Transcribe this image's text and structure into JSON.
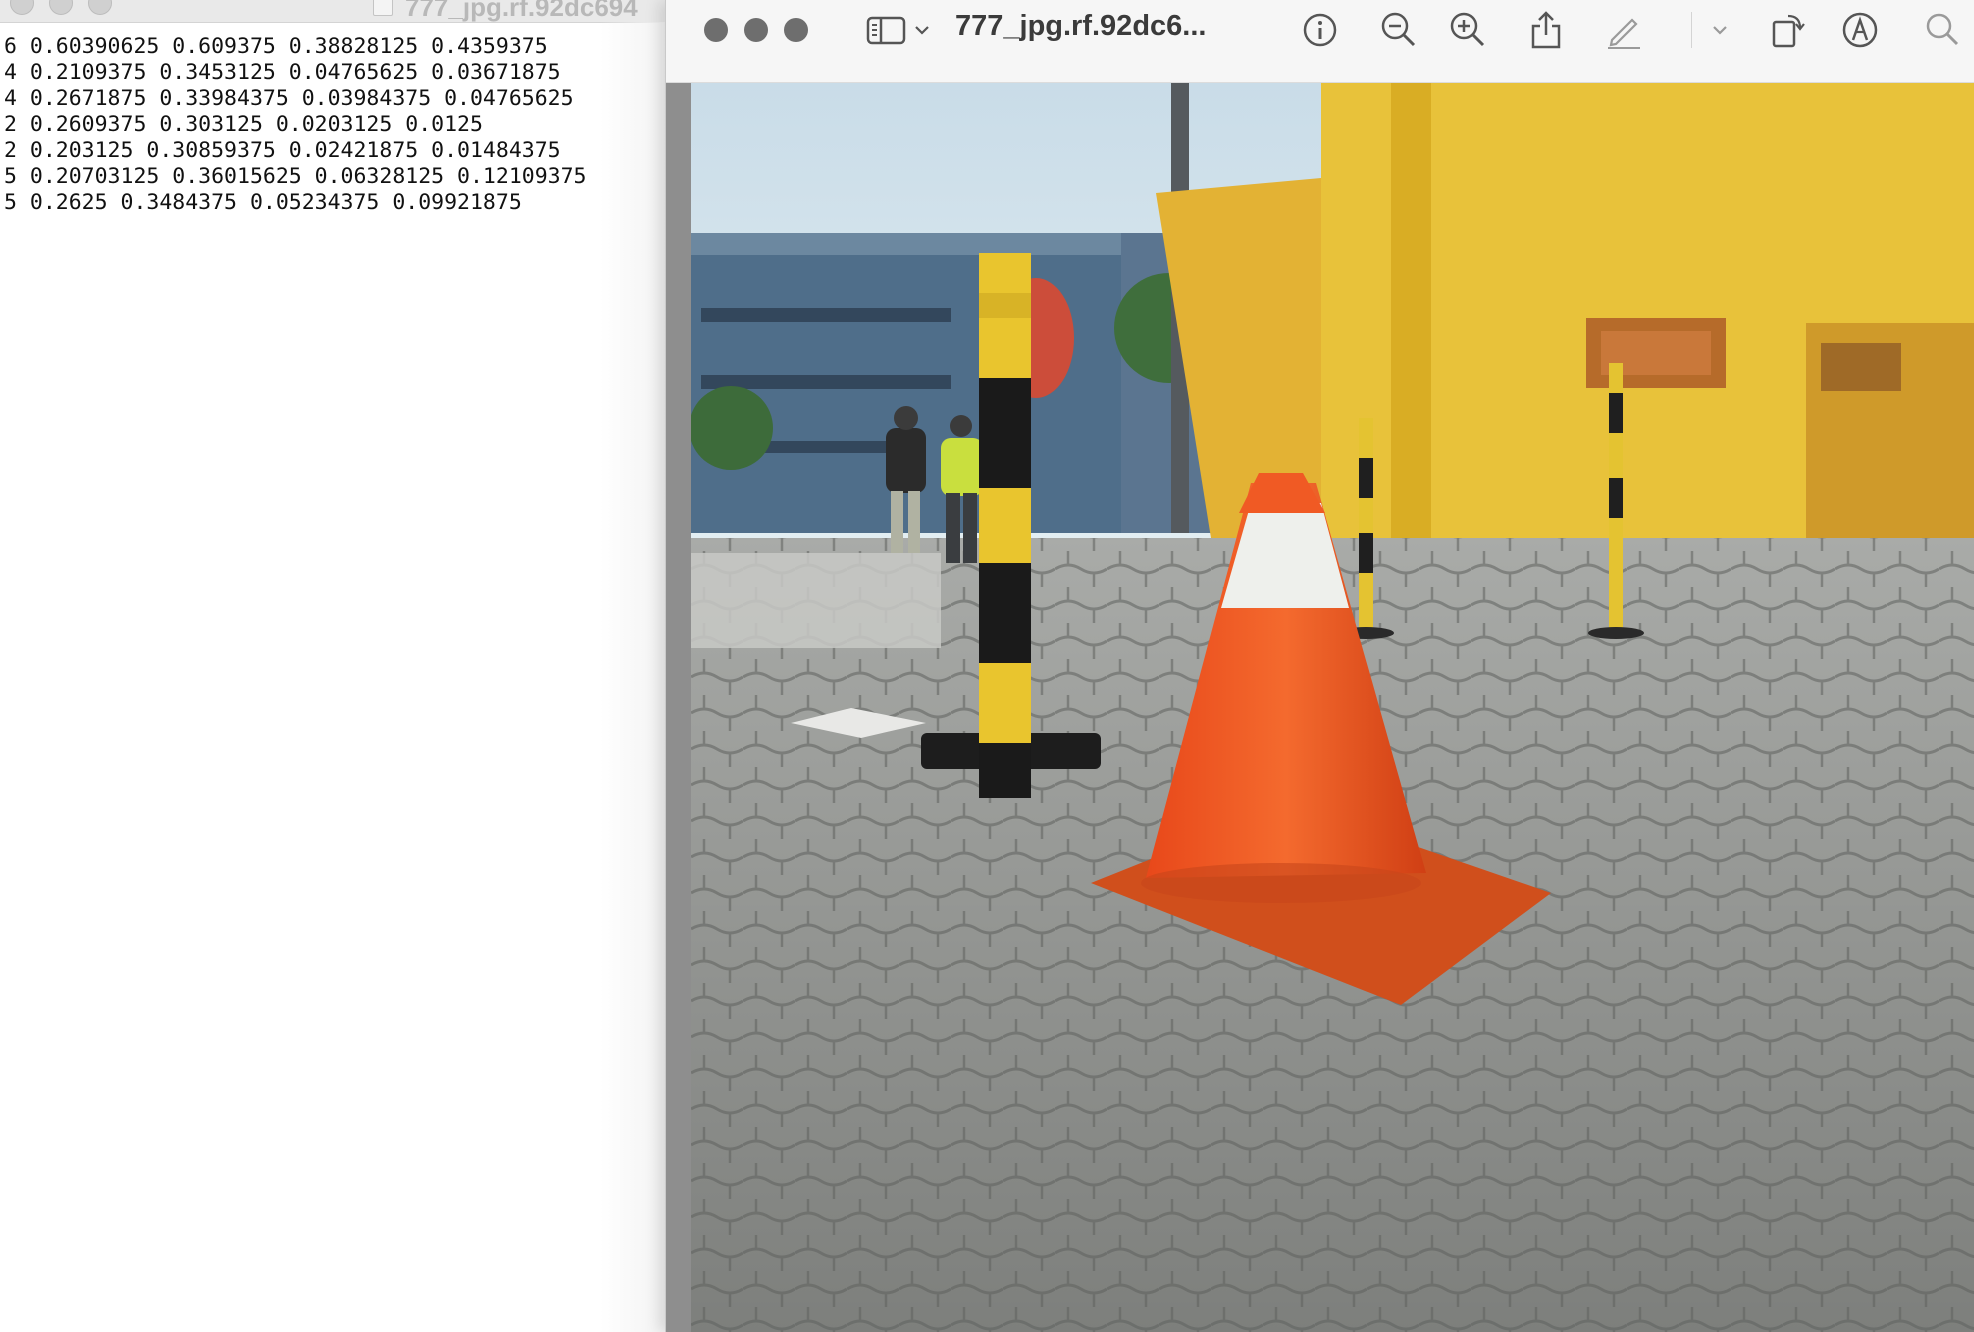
{
  "text_window": {
    "title": "777_jpg.rf.92dc694",
    "lines": [
      "6 0.60390625 0.609375 0.38828125 0.4359375",
      "4 0.2109375 0.3453125 0.04765625 0.03671875",
      "4 0.2671875 0.33984375 0.03984375 0.04765625",
      "2 0.2609375 0.303125 0.0203125 0.0125",
      "2 0.203125 0.30859375 0.02421875 0.01484375",
      "5 0.20703125 0.36015625 0.06328125 0.12109375",
      "5 0.2625 0.3484375 0.05234375 0.09921875"
    ]
  },
  "preview_window": {
    "title": "777_jpg.rf.92dc6...",
    "toolbar_icons": [
      "sidebar-icon",
      "chevron-down-icon",
      "info-icon",
      "zoom-out-icon",
      "zoom-in-icon",
      "share-icon",
      "markup-pen-icon",
      "chevron-down-icon",
      "rotate-icon",
      "annotate-icon",
      "search-icon"
    ],
    "image_description": ""
  },
  "colors": {
    "traffic_light": "#6e6e6e",
    "cone_orange": "#f2541f",
    "wall_yellow": "#e8c23a"
  }
}
